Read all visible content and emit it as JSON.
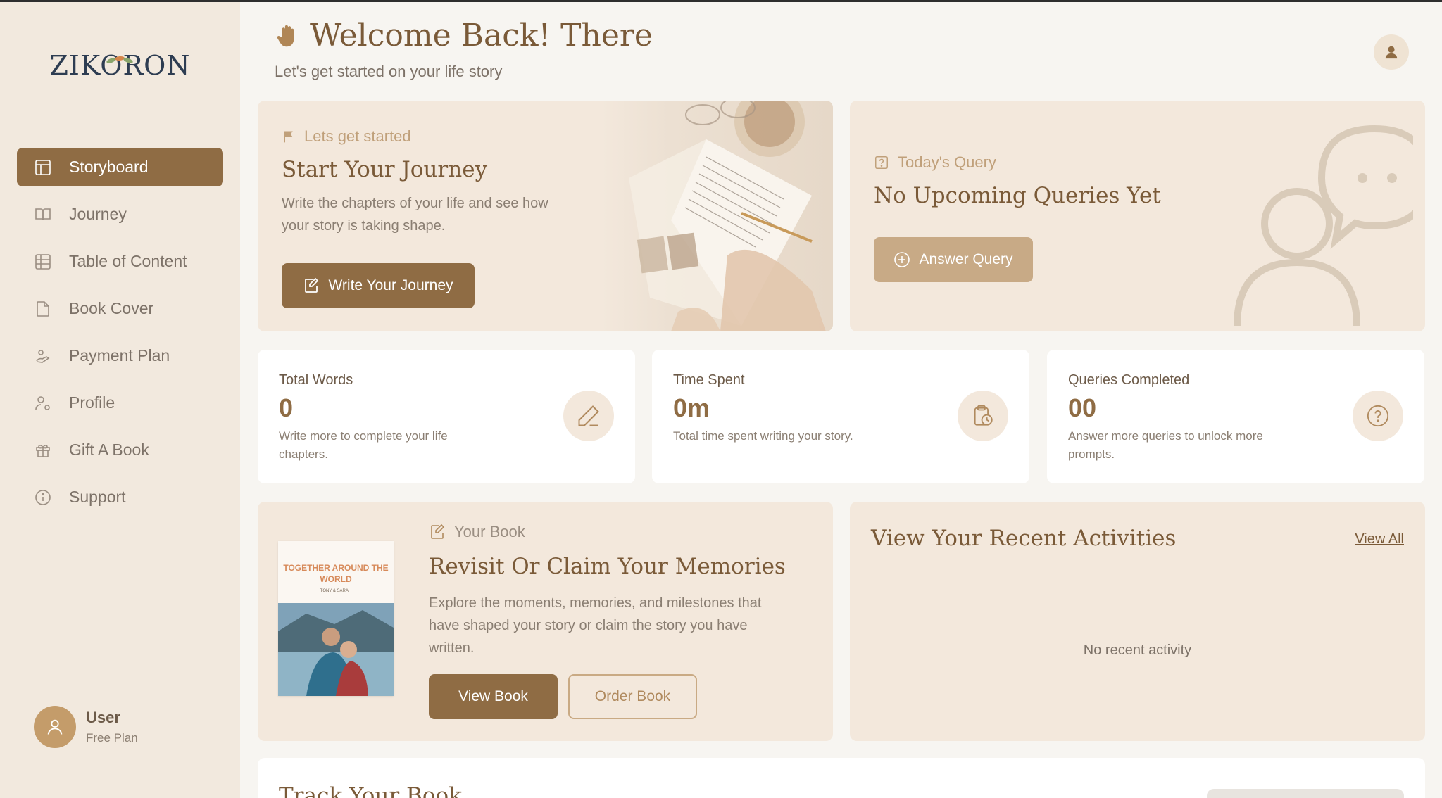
{
  "sidebar": {
    "logo": "ZIKORON",
    "items": [
      {
        "label": "Storyboard",
        "icon": "layout-icon",
        "active": true
      },
      {
        "label": "Journey",
        "icon": "book-open-icon"
      },
      {
        "label": "Table of Content",
        "icon": "table-icon"
      },
      {
        "label": "Book Cover",
        "icon": "file-icon"
      },
      {
        "label": "Payment Plan",
        "icon": "payment-icon"
      },
      {
        "label": "Profile",
        "icon": "user-settings-icon"
      },
      {
        "label": "Gift A Book",
        "icon": "gift-icon"
      },
      {
        "label": "Support",
        "icon": "info-icon"
      }
    ],
    "user": {
      "name": "User",
      "plan": "Free Plan"
    }
  },
  "header": {
    "title": "Welcome Back! There",
    "subtitle": "Let's get started on your life story"
  },
  "journey_card": {
    "eyebrow": "Lets get started",
    "title": "Start Your Journey",
    "description": "Write the chapters of your life and see how your story is taking shape.",
    "button": "Write Your Journey"
  },
  "query_card": {
    "eyebrow": "Today's Query",
    "title": "No Upcoming Queries Yet",
    "button": "Answer Query"
  },
  "stats": [
    {
      "label": "Total Words",
      "value": "0",
      "description": "Write more to complete your life chapters."
    },
    {
      "label": "Time Spent",
      "value": "0m",
      "description": "Total time spent writing your story."
    },
    {
      "label": "Queries Completed",
      "value": "00",
      "description": "Answer more queries to unlock more prompts."
    }
  ],
  "book_card": {
    "eyebrow": "Your Book",
    "title": "Revisit Or Claim Your Memories",
    "description": "Explore the moments, memories, and milestones that have shaped your story or claim the story you have written.",
    "cover_title": "TOGETHER AROUND THE WORLD",
    "cover_authors": "TONY & SARAH",
    "view_button": "View Book",
    "order_button": "Order Book"
  },
  "activities": {
    "title": "View Your Recent Activities",
    "view_all": "View All",
    "empty": "No recent activity"
  },
  "track": {
    "title": "Track Your Book"
  }
}
